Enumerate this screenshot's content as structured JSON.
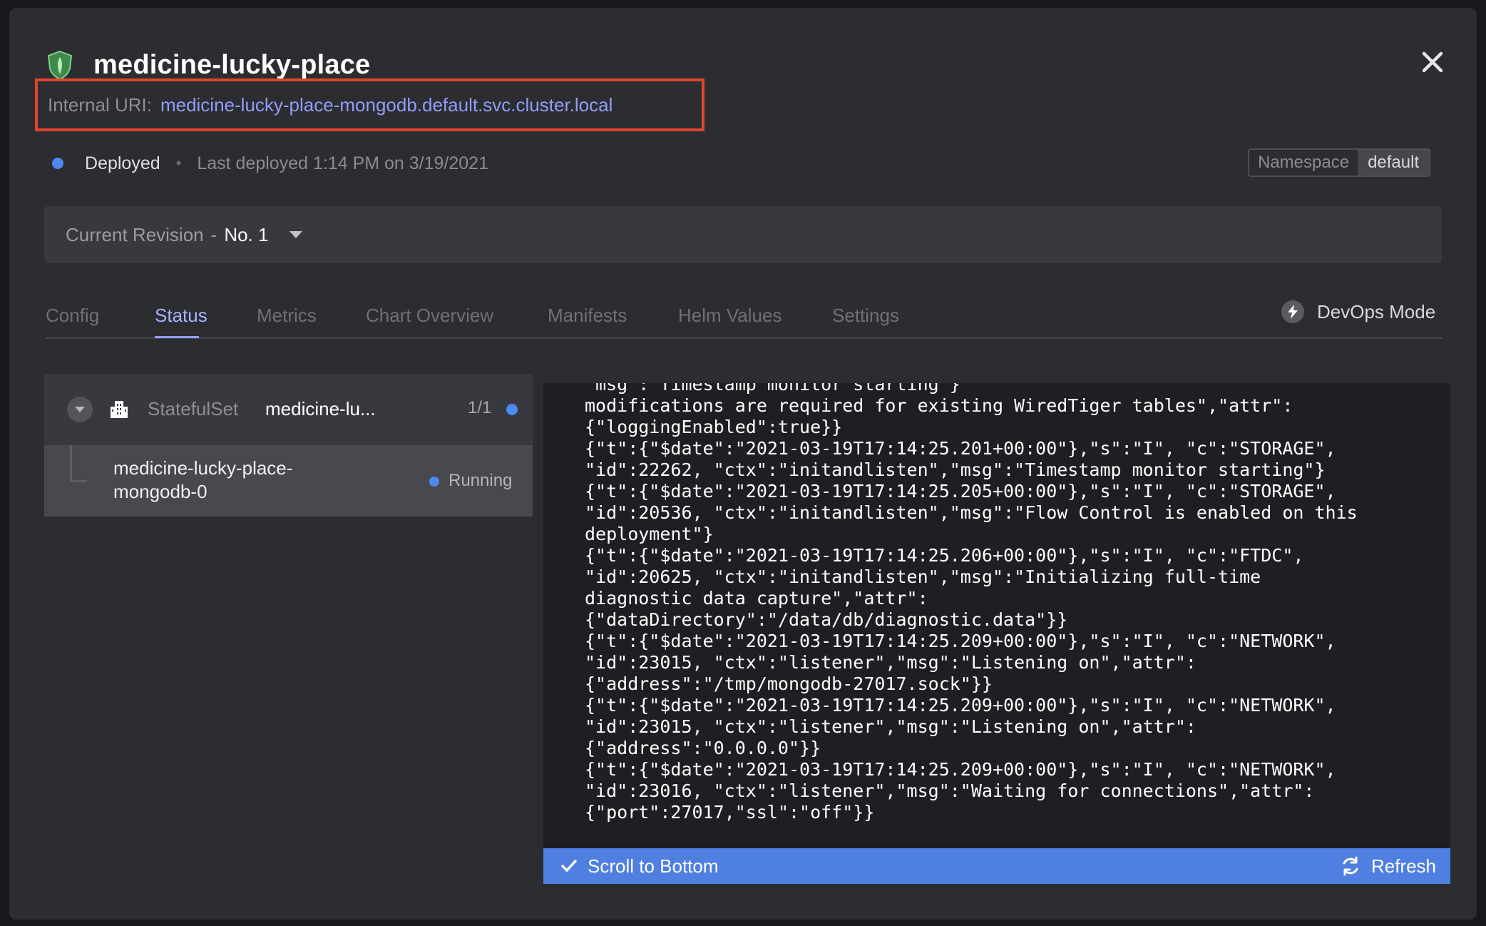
{
  "header": {
    "title": "medicine-lucky-place",
    "uri_label": "Internal URI:",
    "uri_value": "medicine-lucky-place-mongodb.default.svc.cluster.local"
  },
  "status": {
    "state": "Deployed",
    "separator": "•",
    "last_deployed": "Last deployed 1:14 PM on 3/19/2021"
  },
  "namespace": {
    "label": "Namespace",
    "value": "default"
  },
  "revision": {
    "label": "Current Revision",
    "dash": "-",
    "value": "No. 1"
  },
  "tabs": [
    {
      "label": "Config"
    },
    {
      "label": "Status"
    },
    {
      "label": "Metrics"
    },
    {
      "label": "Chart Overview"
    },
    {
      "label": "Manifests"
    },
    {
      "label": "Helm Values"
    },
    {
      "label": "Settings"
    }
  ],
  "active_tab": "Status",
  "devops": {
    "label": "DevOps Mode"
  },
  "sidebar": {
    "statefulset": {
      "kind": "StatefulSet",
      "name": "medicine-lu...",
      "count": "1/1"
    },
    "pod": {
      "name": "medicine-lucky-place-mongodb-0",
      "status": "Running"
    }
  },
  "logs": {
    "lines": [
      "\"msg\":\"Timestamp monitor starting\"}",
      "modifications are required for existing WiredTiger tables\",\"attr\":",
      "{\"loggingEnabled\":true}}",
      "{\"t\":{\"$date\":\"2021-03-19T17:14:25.201+00:00\"},\"s\":\"I\", \"c\":\"STORAGE\",",
      "\"id\":22262, \"ctx\":\"initandlisten\",\"msg\":\"Timestamp monitor starting\"}",
      "{\"t\":{\"$date\":\"2021-03-19T17:14:25.205+00:00\"},\"s\":\"I\", \"c\":\"STORAGE\",",
      "\"id\":20536, \"ctx\":\"initandlisten\",\"msg\":\"Flow Control is enabled on this",
      "deployment\"}",
      "{\"t\":{\"$date\":\"2021-03-19T17:14:25.206+00:00\"},\"s\":\"I\", \"c\":\"FTDC\",",
      "\"id\":20625, \"ctx\":\"initandlisten\",\"msg\":\"Initializing full-time",
      "diagnostic data capture\",\"attr\":",
      "{\"dataDirectory\":\"/data/db/diagnostic.data\"}}",
      "{\"t\":{\"$date\":\"2021-03-19T17:14:25.209+00:00\"},\"s\":\"I\", \"c\":\"NETWORK\",",
      "\"id\":23015, \"ctx\":\"listener\",\"msg\":\"Listening on\",\"attr\":",
      "{\"address\":\"/tmp/mongodb-27017.sock\"}}",
      "{\"t\":{\"$date\":\"2021-03-19T17:14:25.209+00:00\"},\"s\":\"I\", \"c\":\"NETWORK\",",
      "\"id\":23015, \"ctx\":\"listener\",\"msg\":\"Listening on\",\"attr\":",
      "{\"address\":\"0.0.0.0\"}}",
      "{\"t\":{\"$date\":\"2021-03-19T17:14:25.209+00:00\"},\"s\":\"I\", \"c\":\"NETWORK\",",
      "\"id\":23016, \"ctx\":\"listener\",\"msg\":\"Waiting for connections\",\"attr\":",
      "{\"port\":27017,\"ssl\":\"off\"}}"
    ],
    "scroll_label": "Scroll to Bottom",
    "refresh_label": "Refresh"
  },
  "colors": {
    "accent": "#949cf7",
    "status_blue": "#4e89f2",
    "highlight_border": "#e2432a",
    "log_bar": "#4f7fe0"
  }
}
